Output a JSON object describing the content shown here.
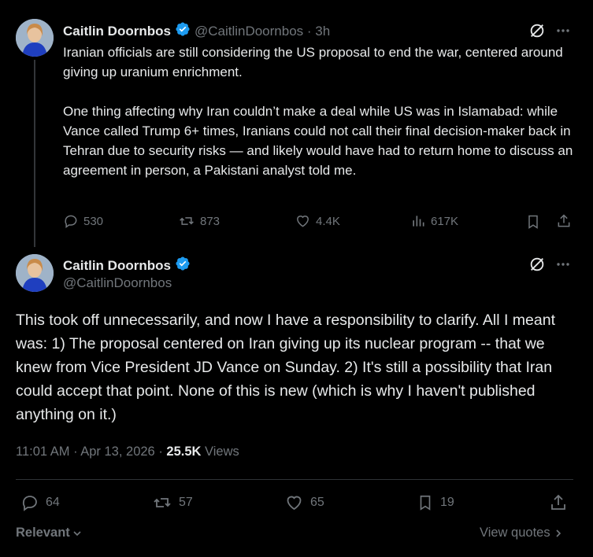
{
  "original_post": {
    "author_name": "Caitlin Doornbos",
    "handle_time": "@CaitlinDoornbos · 3h",
    "text": "Iranian officials are still considering the US proposal to end the war, centered around giving up uranium enrichment.\n\nOne thing affecting why Iran couldn’t make a deal while US was in Islamabad: while Vance called Trump 6+ times, Iranians could not call their final decision-maker back in Tehran due to security risks — and likely would have had to return home to discuss an agreement in person, a Pakistani analyst told me.",
    "replies": "530",
    "reposts": "873",
    "likes": "4.4K",
    "views": "617K"
  },
  "main_post": {
    "author_name": "Caitlin Doornbos",
    "handle": "@CaitlinDoornbos",
    "text": "This took off unnecessarily, and now I have a responsibility to clarify. All I meant was: 1) The proposal centered on Iran giving up its nuclear program -- that we knew from Vice President JD Vance on Sunday. 2) It's still a possibility that Iran could accept that point. None of this is new (which is why I haven't published anything on it.)",
    "timestamp": "11:01 AM · Apr 13, 2026 · ",
    "views_count": "25.5K",
    "views_label": " Views",
    "replies": "64",
    "reposts": "57",
    "likes": "65",
    "bookmarks": "19"
  },
  "footer": {
    "sort_label": "Relevant",
    "view_quotes_label": "View quotes"
  },
  "colors": {
    "verified": "#1d9bf0",
    "muted": "#71767b",
    "text": "#e7e9ea",
    "background": "#000000"
  }
}
